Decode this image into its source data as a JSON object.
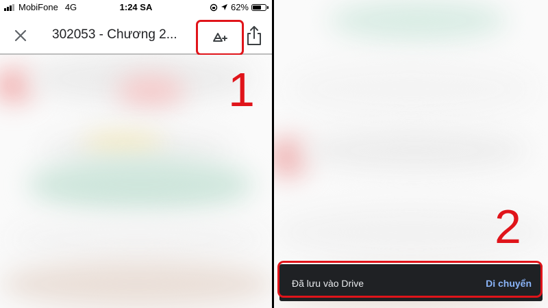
{
  "status_bar": {
    "carrier": "MobiFone",
    "network": "4G",
    "time": "1:24 SA",
    "battery_percent": "62%",
    "battery_level": 0.62
  },
  "toolbar": {
    "title": "302053 - Chương 2...",
    "close_icon": "close-icon",
    "add_to_drive_icon": "add-to-drive-icon",
    "share_icon": "share-icon"
  },
  "steps": {
    "step1": "1",
    "step2": "2"
  },
  "snackbar": {
    "message": "Đã lưu vào Drive",
    "action": "Di chuyển"
  },
  "colors": {
    "highlight": "#e0141a",
    "snackbar_bg": "#1f2124",
    "snackbar_action": "#8ab4f8"
  }
}
